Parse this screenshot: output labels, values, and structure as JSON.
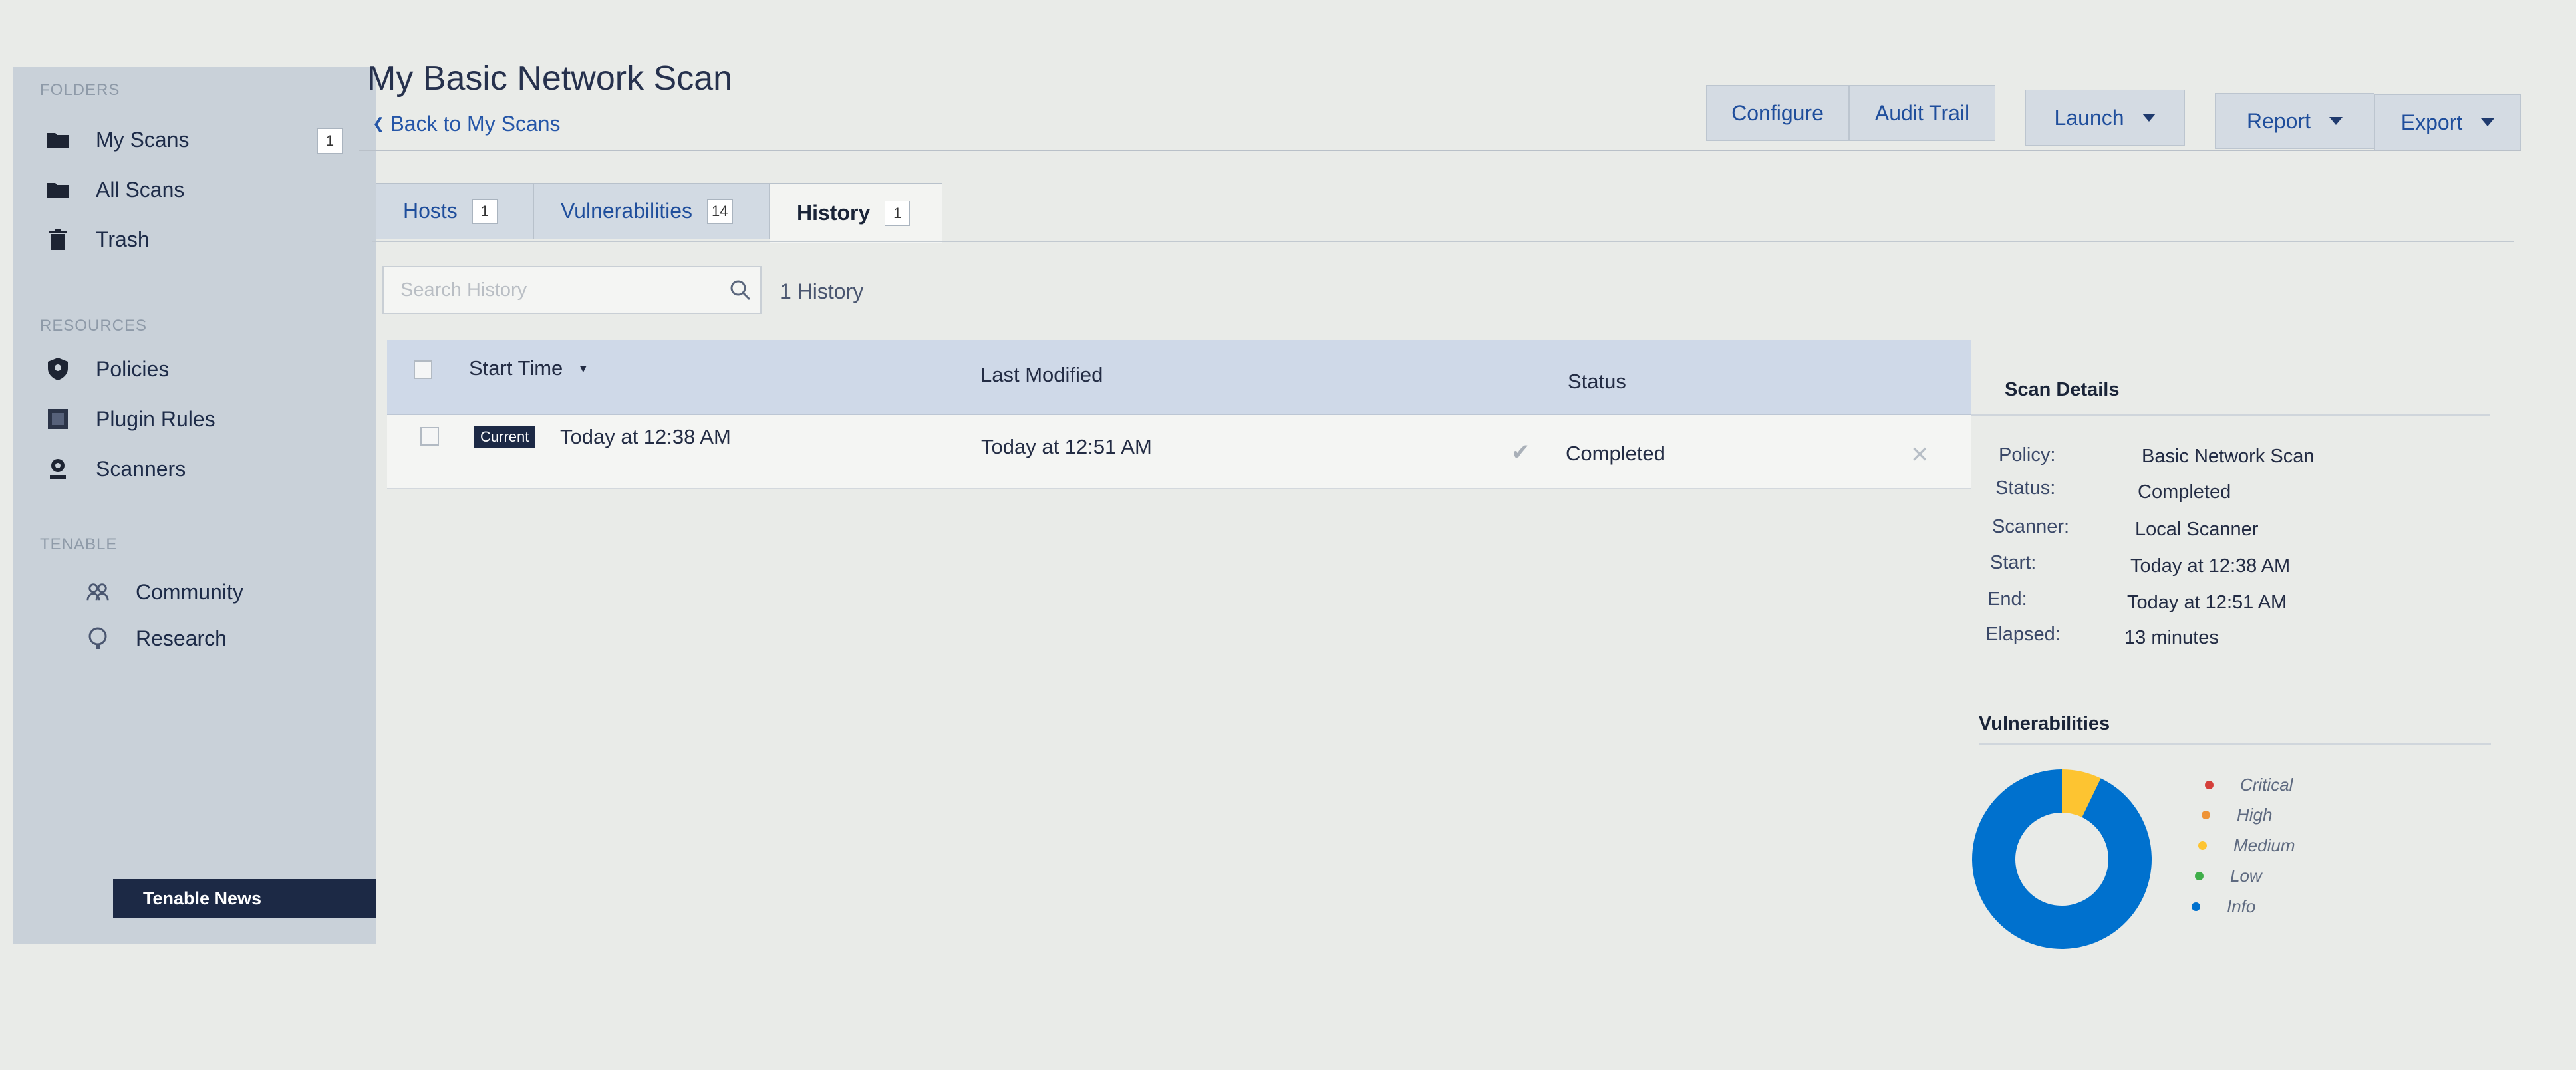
{
  "header": {
    "title": "My Basic Network Scan",
    "back_link": "Back to My Scans",
    "buttons": {
      "configure": "Configure",
      "audit_trail": "Audit Trail",
      "launch": "Launch",
      "report": "Report",
      "export": "Export"
    }
  },
  "sidebar": {
    "folders_heading": "FOLDERS",
    "folders": [
      {
        "label": "My Scans",
        "count": "1",
        "icon": "folder-icon"
      },
      {
        "label": "All Scans",
        "icon": "folder-icon"
      },
      {
        "label": "Trash",
        "icon": "trash-icon"
      }
    ],
    "resources_heading": "RESOURCES",
    "resources": [
      {
        "label": "Policies",
        "icon": "shield-icon"
      },
      {
        "label": "Plugin Rules",
        "icon": "plugin-icon"
      },
      {
        "label": "Scanners",
        "icon": "scanner-icon"
      }
    ],
    "tenable_heading": "TENABLE",
    "tenable": [
      {
        "label": "Community",
        "icon": "community-icon"
      },
      {
        "label": "Research",
        "icon": "research-icon"
      }
    ],
    "news_label": "Tenable News"
  },
  "tabs": [
    {
      "label": "Hosts",
      "count": "1"
    },
    {
      "label": "Vulnerabilities",
      "count": "14"
    },
    {
      "label": "History",
      "count": "1",
      "active": true
    }
  ],
  "search": {
    "placeholder": "Search History",
    "result_count": "1 History"
  },
  "table": {
    "columns": [
      "Start Time",
      "Last Modified",
      "Status"
    ],
    "rows": [
      {
        "badge": "Current",
        "start_time": "Today at 12:38 AM",
        "last_modified": "Today at 12:51 AM",
        "status": "Completed"
      }
    ]
  },
  "scan_details": {
    "title": "Scan Details",
    "fields": [
      {
        "label": "Policy:",
        "value": "Basic Network Scan"
      },
      {
        "label": "Status:",
        "value": "Completed"
      },
      {
        "label": "Scanner:",
        "value": "Local Scanner"
      },
      {
        "label": "Start:",
        "value": "Today at 12:38 AM"
      },
      {
        "label": "End:",
        "value": "Today at 12:51 AM"
      },
      {
        "label": "Elapsed:",
        "value": "13 minutes"
      }
    ]
  },
  "vulnerabilities": {
    "title": "Vulnerabilities",
    "legend": [
      {
        "label": "Critical",
        "color": "#d43f3a"
      },
      {
        "label": "High",
        "color": "#ee9336"
      },
      {
        "label": "Medium",
        "color": "#fdc431"
      },
      {
        "label": "Low",
        "color": "#3fae49"
      },
      {
        "label": "Info",
        "color": "#0071ce"
      }
    ],
    "chart_data": {
      "type": "pie",
      "categories": [
        "Critical",
        "High",
        "Medium",
        "Low",
        "Info"
      ],
      "values": [
        0,
        0,
        1,
        0,
        13
      ]
    }
  }
}
